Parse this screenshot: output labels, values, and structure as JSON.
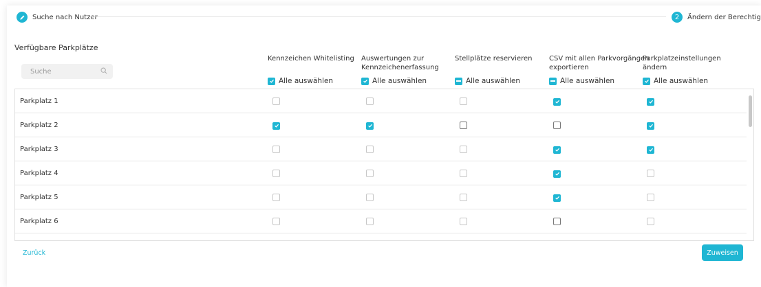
{
  "stepper": {
    "step1_label": "Suche nach Nutzer",
    "step2_number": "2",
    "step2_label": "Ändern der Berechtigungen"
  },
  "section_title": "Verfügbare Parkplätze",
  "search": {
    "placeholder": "Suche",
    "value": ""
  },
  "select_all_label": "Alle auswählen",
  "columns": [
    {
      "title_lines": [
        "Kennzeichen Whitelisting",
        ""
      ],
      "select_all": "checked"
    },
    {
      "title_lines": [
        "Auswertungen zur",
        "Kennzeichenerfassung"
      ],
      "select_all": "checked"
    },
    {
      "title_lines": [
        "Stellplätze reservieren",
        ""
      ],
      "select_all": "indeterminate"
    },
    {
      "title_lines": [
        "CSV mit allen Parkvorgängen",
        "exportieren"
      ],
      "select_all": "indeterminate"
    },
    {
      "title_lines": [
        "Parkplatzeinstellungen",
        "ändern"
      ],
      "select_all": "checked"
    }
  ],
  "rows": [
    {
      "label": "Parkplatz 1",
      "cells": [
        "off",
        "off",
        "off",
        "on",
        "on"
      ]
    },
    {
      "label": "Parkplatz 2",
      "cells": [
        "on",
        "on",
        "off-dark",
        "off-dark",
        "on"
      ]
    },
    {
      "label": "Parkplatz 3",
      "cells": [
        "off",
        "off",
        "off",
        "on",
        "on"
      ]
    },
    {
      "label": "Parkplatz 4",
      "cells": [
        "off",
        "off",
        "off",
        "on",
        "off"
      ]
    },
    {
      "label": "Parkplatz 5",
      "cells": [
        "off",
        "off",
        "off",
        "on",
        "off"
      ]
    },
    {
      "label": "Parkplatz 6",
      "cells": [
        "off",
        "off",
        "off",
        "off-dark",
        "off"
      ]
    }
  ],
  "footer": {
    "back_label": "Zurück",
    "assign_label": "Zuweisen"
  },
  "colors": {
    "accent": "#1fb6d3",
    "border": "#e0e0e0",
    "text": "#333333"
  }
}
